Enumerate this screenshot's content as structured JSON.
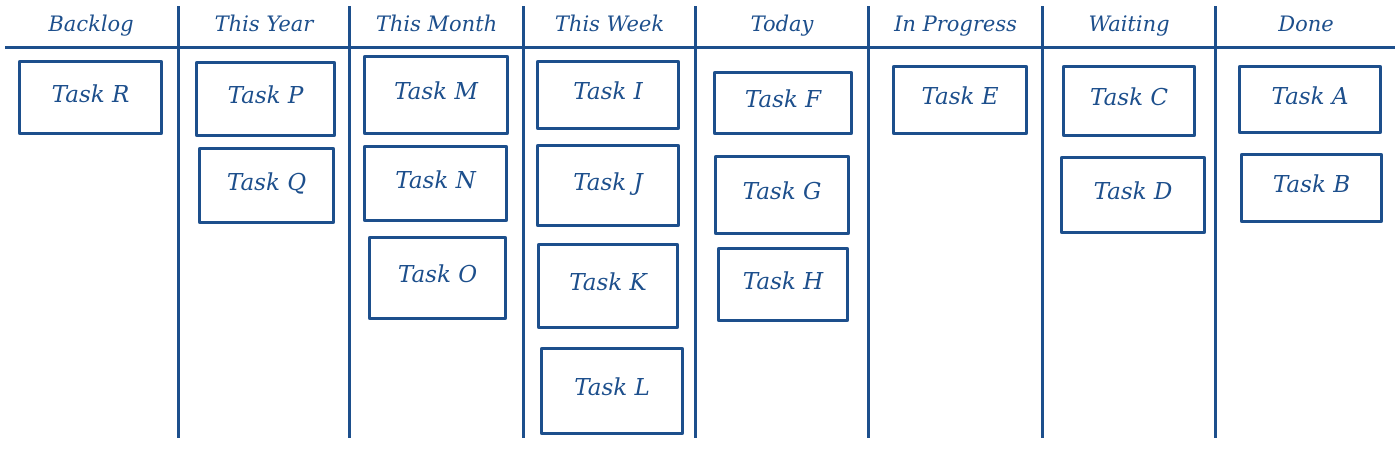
{
  "colors": {
    "ink": "#1d4f8c"
  },
  "columns": [
    {
      "title": "Backlog",
      "cards": [
        "Task R"
      ]
    },
    {
      "title": "This Year",
      "cards": [
        "Task P",
        "Task Q"
      ]
    },
    {
      "title": "This Month",
      "cards": [
        "Task M",
        "Task N",
        "Task O"
      ]
    },
    {
      "title": "This Week",
      "cards": [
        "Task I",
        "Task J",
        "Task K",
        "Task L"
      ]
    },
    {
      "title": "Today",
      "cards": [
        "Task F",
        "Task G",
        "Task H"
      ]
    },
    {
      "title": "In Progress",
      "cards": [
        "Task E"
      ]
    },
    {
      "title": "Waiting",
      "cards": [
        "Task C",
        "Task D"
      ]
    },
    {
      "title": "Done",
      "cards": [
        "Task A",
        "Task B"
      ]
    }
  ]
}
